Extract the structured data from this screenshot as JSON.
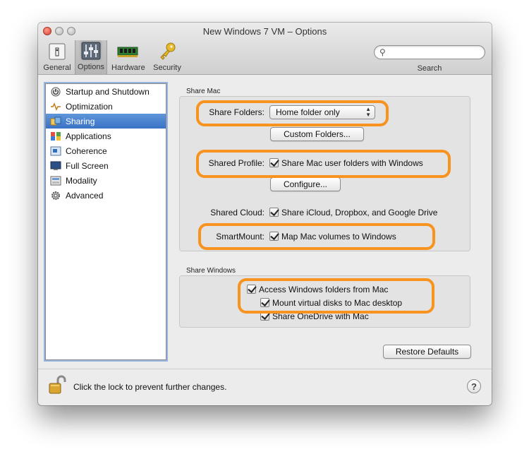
{
  "window": {
    "title": "New Windows 7 VM – Options"
  },
  "toolbar": {
    "items": [
      {
        "label": "General",
        "icon": "general-icon"
      },
      {
        "label": "Options",
        "icon": "options-icon",
        "selected": true
      },
      {
        "label": "Hardware",
        "icon": "hardware-icon"
      },
      {
        "label": "Security",
        "icon": "key-icon"
      }
    ],
    "search_label": "Search",
    "search_placeholder": ""
  },
  "sidebar": {
    "items": [
      {
        "label": "Startup and Shutdown",
        "icon": "power-icon"
      },
      {
        "label": "Optimization",
        "icon": "pulse-icon"
      },
      {
        "label": "Sharing",
        "icon": "folders-icon",
        "selected": true
      },
      {
        "label": "Applications",
        "icon": "apps-icon"
      },
      {
        "label": "Coherence",
        "icon": "coherence-icon"
      },
      {
        "label": "Full Screen",
        "icon": "fullscreen-icon"
      },
      {
        "label": "Modality",
        "icon": "modality-icon"
      },
      {
        "label": "Advanced",
        "icon": "gear-icon"
      }
    ]
  },
  "share_mac": {
    "group_label": "Share Mac",
    "share_folders_label": "Share Folders:",
    "share_folders_value": "Home folder only",
    "custom_folders_button": "Custom Folders...",
    "shared_profile_label": "Shared Profile:",
    "shared_profile_check": "Share Mac user folders with Windows",
    "configure_button": "Configure...",
    "shared_cloud_label": "Shared Cloud:",
    "shared_cloud_check": "Share iCloud, Dropbox, and Google Drive",
    "smartmount_label": "SmartMount:",
    "smartmount_check": "Map Mac volumes to Windows"
  },
  "share_windows": {
    "group_label": "Share Windows",
    "access_check": "Access Windows folders from Mac",
    "mount_check": "Mount virtual disks to Mac desktop",
    "onedrive_check": "Share OneDrive with Mac"
  },
  "restore_defaults_button": "Restore Defaults",
  "bottom": {
    "lock_text": "Click the lock to prevent further changes.",
    "help": "?"
  },
  "colors": {
    "highlight": "#f7931e",
    "selection": "#3a73c6"
  }
}
